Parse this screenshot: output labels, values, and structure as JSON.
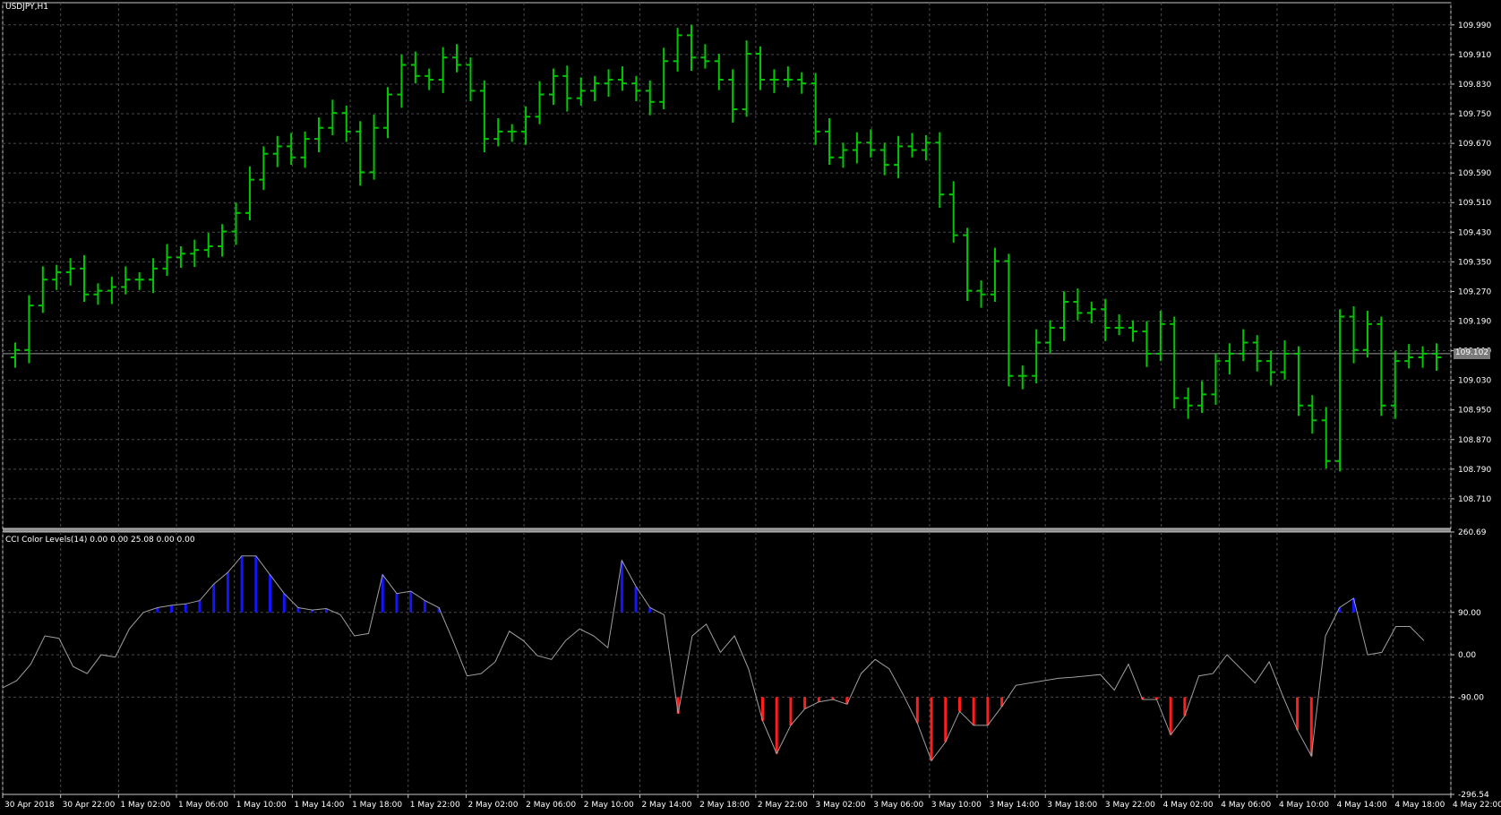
{
  "symbol_label": "USDJPY,H1",
  "indicator_label": "CCI Color Levels(14) 0.00 0.00 25.08 0.00 0.00",
  "current_price_label": "109.102",
  "colors": {
    "background": "#000000",
    "grid": "#4a4a4a",
    "candle": "#00c800",
    "cci_line": "#a0a0a0",
    "cci_up": "#1414ff",
    "cci_down": "#ff1e1e",
    "price_tag_bg": "#7a7a7a"
  },
  "chart_data": [
    {
      "type": "ohlc",
      "title": "USDJPY,H1",
      "ylim": [
        108.63,
        110.05
      ],
      "y_ticks": [
        "109.990",
        "109.910",
        "109.830",
        "109.750",
        "109.670",
        "109.590",
        "109.510",
        "109.430",
        "109.350",
        "109.270",
        "109.190",
        "109.110",
        "109.030",
        "108.950",
        "108.870",
        "108.790",
        "108.710"
      ],
      "x_labels": [
        "30 Apr 2018",
        "30 Apr 22:00",
        "1 May 02:00",
        "1 May 06:00",
        "1 May 10:00",
        "1 May 14:00",
        "1 May 18:00",
        "1 May 22:00",
        "2 May 02:00",
        "2 May 06:00",
        "2 May 10:00",
        "2 May 14:00",
        "2 May 18:00",
        "2 May 22:00",
        "3 May 02:00",
        "3 May 06:00",
        "3 May 10:00",
        "3 May 14:00",
        "3 May 18:00",
        "3 May 22:00",
        "4 May 02:00",
        "4 May 06:00",
        "4 May 10:00",
        "4 May 14:00",
        "4 May 18:00",
        "4 May 22:00"
      ],
      "current_price": 109.102,
      "closes": [
        109.112,
        109.232,
        109.302,
        109.322,
        109.332,
        109.262,
        109.272,
        109.282,
        109.302,
        109.302,
        109.332,
        109.362,
        109.372,
        109.382,
        109.392,
        109.432,
        109.482,
        109.572,
        109.642,
        109.662,
        109.632,
        109.682,
        109.712,
        109.752,
        109.702,
        109.592,
        109.712,
        109.802,
        109.882,
        109.852,
        109.842,
        109.902,
        109.882,
        109.812,
        109.682,
        109.702,
        109.702,
        109.742,
        109.802,
        109.852,
        109.792,
        109.812,
        109.832,
        109.842,
        109.832,
        109.812,
        109.782,
        109.892,
        109.962,
        109.902,
        109.892,
        109.842,
        109.762,
        109.912,
        109.842,
        109.842,
        109.842,
        109.832,
        109.702,
        109.632,
        109.652,
        109.672,
        109.652,
        109.612,
        109.662,
        109.652,
        109.672,
        109.532,
        109.422,
        109.272,
        109.262,
        109.352,
        109.042,
        109.042,
        109.132,
        109.172,
        109.242,
        109.212,
        109.222,
        109.172,
        109.172,
        109.162,
        109.102,
        109.182,
        108.982,
        108.962,
        108.992,
        109.082,
        109.102,
        109.132,
        109.082,
        109.052,
        109.102,
        108.962,
        108.922,
        108.812,
        109.202,
        109.112,
        109.182,
        108.962,
        109.082,
        109.092,
        109.102,
        109.092
      ]
    },
    {
      "type": "line",
      "title": "CCI Color Levels(14) 0.00 0.00 25.08 0.00 0.00",
      "ylim": [
        -296.54,
        260.69
      ],
      "y_ticks": [
        "260.69",
        "90.00",
        "0.00",
        "-90.00",
        "-296.54"
      ],
      "upper_level": 90,
      "lower_level": -90,
      "values": [
        -70,
        -55,
        -20,
        40,
        35,
        -25,
        -40,
        0,
        -5,
        55,
        90,
        100,
        105,
        108,
        115,
        150,
        175,
        210,
        210,
        170,
        130,
        100,
        95,
        98,
        85,
        40,
        45,
        170,
        130,
        135,
        115,
        100,
        30,
        -45,
        -40,
        -15,
        50,
        30,
        -2,
        -10,
        30,
        55,
        40,
        15,
        200,
        145,
        100,
        85,
        -125,
        40,
        65,
        5,
        40,
        -30,
        -140,
        -210,
        -150,
        -115,
        -100,
        -95,
        -105,
        -40,
        -10,
        -30,
        -85,
        -145,
        -225,
        -185,
        -120,
        -150,
        -150,
        -110,
        -65,
        -60,
        -55,
        -50,
        -48,
        -45,
        -42,
        -75,
        -20,
        -95,
        -95,
        -170,
        -130,
        -45,
        -40,
        0,
        -30,
        -60,
        -15,
        -90,
        -160,
        -215,
        40,
        100,
        120,
        0,
        5,
        60,
        60,
        30
      ]
    }
  ]
}
